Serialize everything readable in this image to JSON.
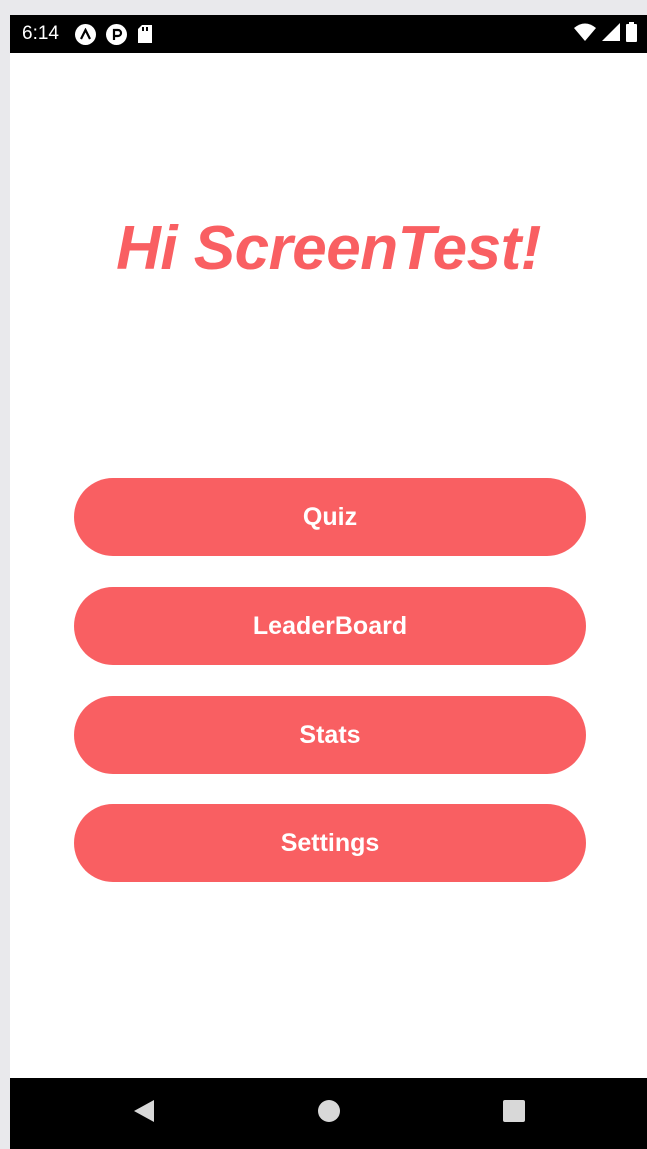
{
  "status_bar": {
    "time": "6:14",
    "icons_left": [
      "a-icon",
      "p-icon",
      "sd-card-icon"
    ],
    "icons_right": [
      "wifi-icon",
      "signal-icon",
      "battery-icon"
    ]
  },
  "title": "Hi ScreenTest!",
  "menu": {
    "quiz_label": "Quiz",
    "leaderboard_label": "LeaderBoard",
    "stats_label": "Stats",
    "settings_label": "Settings"
  },
  "nav_bar": {
    "icons": [
      "back-icon",
      "home-icon",
      "recents-icon"
    ]
  },
  "colors": {
    "accent": "#f95f62",
    "background": "#ffffff",
    "system_bars": "#000000"
  }
}
